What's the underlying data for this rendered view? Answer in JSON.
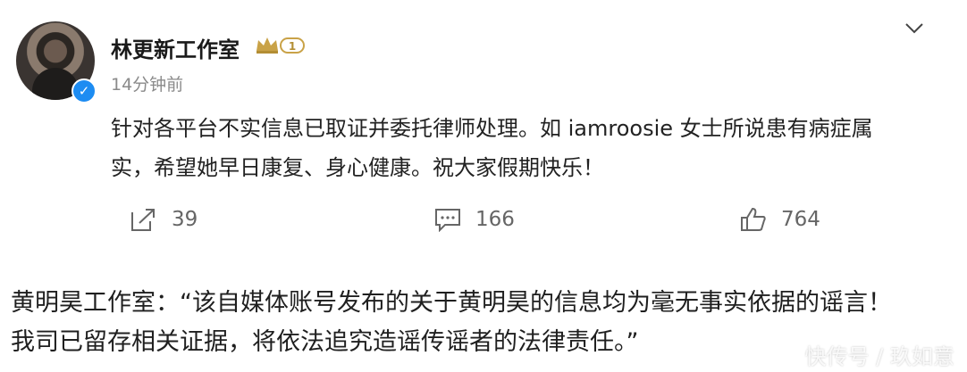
{
  "post": {
    "username": "林更新工作室",
    "vip_badge_level": "1",
    "time": "14分钟前",
    "text_line1": "针对各平台不实信息已取证并委托律师处理。如 iamroosie 女士所说患有病症属",
    "text_line2": "实，希望她早日康复、身心健康。祝大家假期快乐！",
    "actions": {
      "repost_count": "39",
      "comment_count": "166",
      "like_count": "764"
    }
  },
  "quote": {
    "line1": "黄明昊工作室：“该自媒体账号发布的关于黄明昊的信息均为毫无事实依据的谣言！",
    "line2": "我司已留存相关证据，将依法追究造谣传谣者的法律责任。”"
  },
  "watermark": "快传号 / 玖如意",
  "colors": {
    "verified_blue": "#1d8cf2",
    "vip_gold": "#c9a247",
    "meta_gray": "#8a8a8a"
  }
}
